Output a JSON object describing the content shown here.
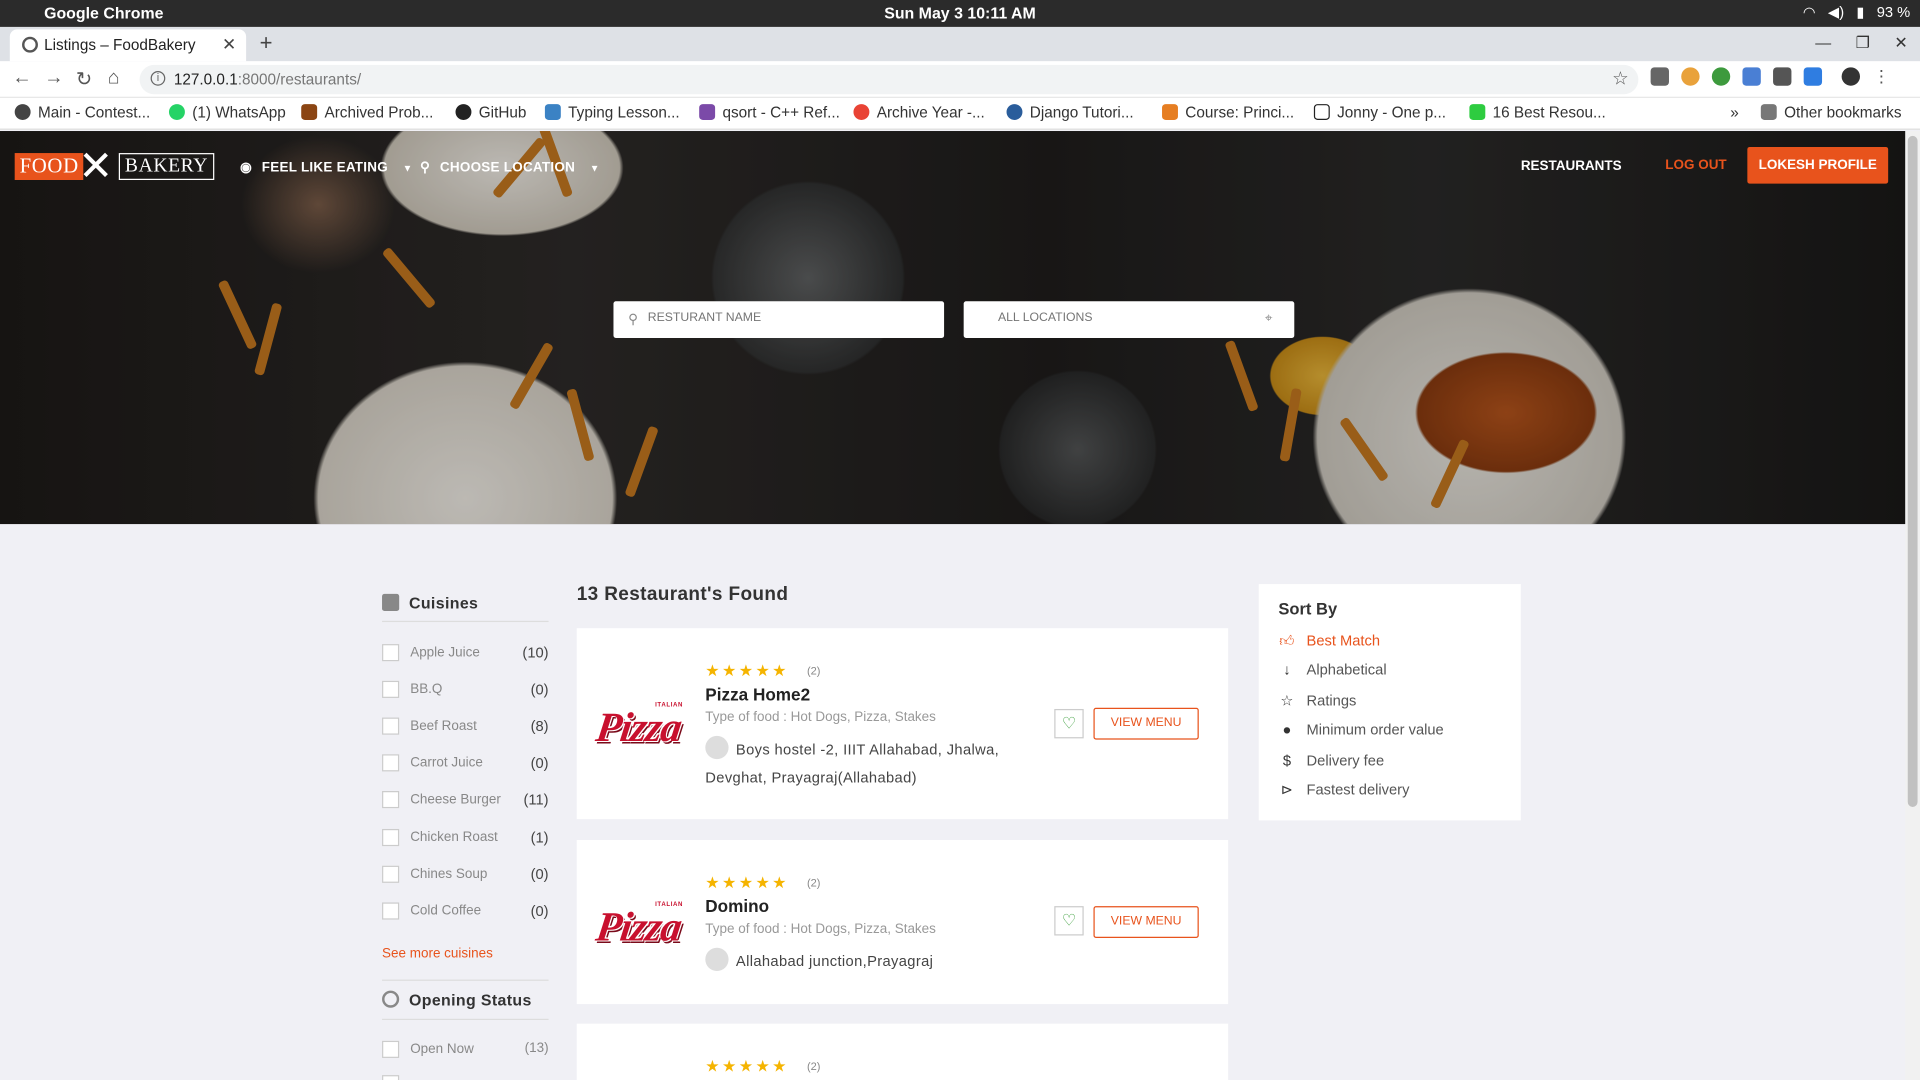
{
  "os": {
    "app_name": "Google Chrome",
    "clock": "Sun May 3  10:11 AM",
    "battery": "93 %"
  },
  "browser": {
    "tab_title": "Listings – FoodBakery",
    "url_host": "127.0.0.1",
    "url_path": ":8000/restaurants/",
    "bookmarks": [
      {
        "label": "Main - Contest...",
        "color": "#444"
      },
      {
        "label": "(1) WhatsApp",
        "color": "#25d366"
      },
      {
        "label": "Archived Prob...",
        "color": "#8b4513"
      },
      {
        "label": "GitHub",
        "color": "#222"
      },
      {
        "label": "Typing Lesson...",
        "color": "#3b82c4"
      },
      {
        "label": "qsort - C++ Ref...",
        "color": "#7b4aa8"
      },
      {
        "label": "Archive Year -...",
        "color": "#e94335"
      },
      {
        "label": "Django Tutori...",
        "color": "#2a5d9b"
      },
      {
        "label": "Course: Princi...",
        "color": "#e67e22"
      },
      {
        "label": "Jonny - One p...",
        "color": "#222"
      },
      {
        "label": "16 Best Resou...",
        "color": "#2ecc40"
      }
    ],
    "bookmarks_overflow": "»",
    "other_bookmarks": "Other bookmarks"
  },
  "header": {
    "logo_food": "FOOD",
    "logo_bakery": "BAKERY",
    "feel_like_eating": "FEEL LIKE EATING",
    "choose_location": "CHOOSE LOCATION",
    "restaurants": "RESTAURANTS",
    "logout": "LOG OUT",
    "profile": "LOKESH PROFILE"
  },
  "search": {
    "name_placeholder": "RESTURANT NAME",
    "location_placeholder": "ALL LOCATIONS"
  },
  "sidebar": {
    "cuisines_title": "Cuisines",
    "cuisines": [
      {
        "label": "Apple Juice",
        "count": "(10)"
      },
      {
        "label": "BB.Q",
        "count": "(0)"
      },
      {
        "label": "Beef Roast",
        "count": "(8)"
      },
      {
        "label": "Carrot Juice",
        "count": "(0)"
      },
      {
        "label": "Cheese Burger",
        "count": "(11)"
      },
      {
        "label": "Chicken Roast",
        "count": "(1)"
      },
      {
        "label": "Chines Soup",
        "count": "(0)"
      },
      {
        "label": "Cold Coffee",
        "count": "(0)"
      }
    ],
    "see_more": "See more cuisines",
    "opening_title": "Opening Status",
    "opening": [
      {
        "label": "Open Now",
        "count": "(13)"
      }
    ]
  },
  "results": {
    "found": "13 Restaurant's Found",
    "restaurants": [
      {
        "logo_italian": "ITALIAN",
        "logo_text": "Pizza",
        "stars": "★★★★★",
        "rating_count": "(2)",
        "name": "Pizza Home2",
        "type": "Type of food : Hot Dogs, Pizza, Stakes",
        "address": "Boys hostel -2, IIIT Allahabad, Jhalwa, Devghat, Prayagraj(Allahabad)",
        "view_menu": "VIEW MENU"
      },
      {
        "logo_italian": "ITALIAN",
        "logo_text": "Pizza",
        "stars": "★★★★★",
        "rating_count": "(2)",
        "name": "Domino",
        "type": "Type of food : Hot Dogs, Pizza, Stakes",
        "address": "Allahabad junction,Prayagraj",
        "view_menu": "VIEW MENU"
      },
      {
        "stars": "★★★★★",
        "rating_count": "(2)"
      }
    ]
  },
  "sort": {
    "title": "Sort By",
    "options": [
      {
        "label": "Best Match",
        "icon": "thumbs-up-icon",
        "active": true
      },
      {
        "label": "Alphabetical",
        "icon": "sort-alpha-icon"
      },
      {
        "label": "Ratings",
        "icon": "star-outline-icon"
      },
      {
        "label": "Minimum order value",
        "icon": "user-order-icon"
      },
      {
        "label": "Delivery fee",
        "icon": "dollar-icon"
      },
      {
        "label": "Fastest delivery",
        "icon": "fast-forward-icon"
      }
    ]
  },
  "colors": {
    "accent": "#e8531c",
    "star": "#f5b400",
    "heart": "#3a9e3a"
  }
}
